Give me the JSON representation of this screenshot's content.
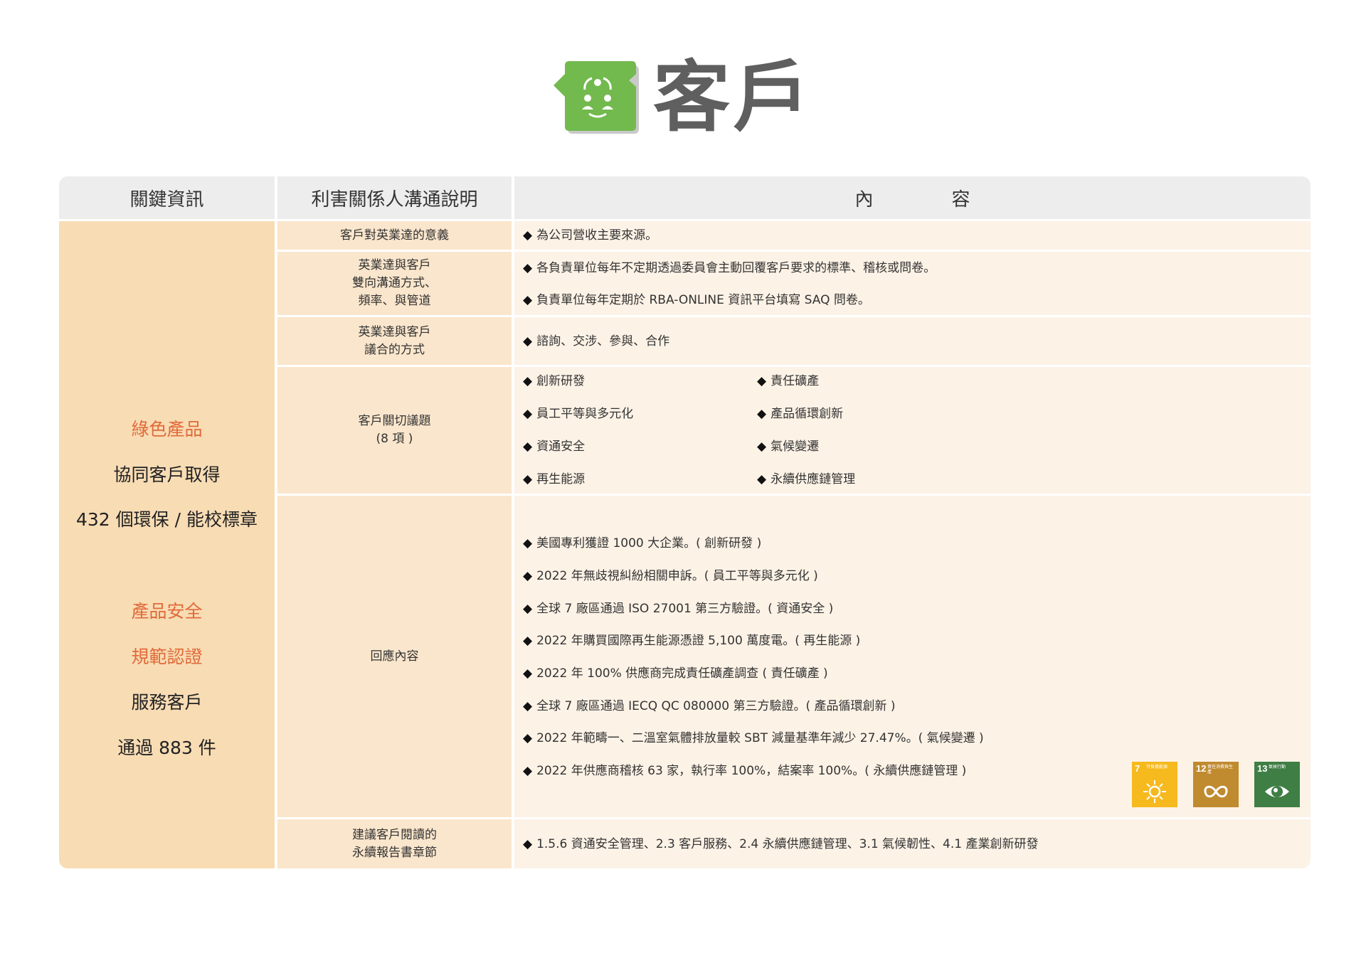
{
  "header": {
    "title": "客戶",
    "icon": "stakeholder-customer-icon",
    "icon_color": "#72b94e"
  },
  "table": {
    "col1_header": "關鍵資訊",
    "col2_header": "利害關係人溝通說明",
    "col3_header_a": "內",
    "col3_header_b": "容",
    "key_info": {
      "l1": "綠色產品",
      "l2": "協同客戶取得",
      "l3": "432 個環保 / 能校標章",
      "l4": "產品安全",
      "l5": "規範認證",
      "l6": "服務客戶",
      "l7": "通過 883 件",
      "highlight_color": "#e06a3a"
    },
    "rows": {
      "significance": {
        "label": "客戶對英業達的意義",
        "items": [
          "為公司營收主要來源。"
        ]
      },
      "channels": {
        "label_1": "英業達與客戶",
        "label_2": "雙向溝通方式、",
        "label_3": "頻率、與管道",
        "items": [
          "各負責單位每年不定期透過委員會主動回覆客戶要求的標準、稽核或問卷。",
          "負責單位每年定期於 RBA-ONLINE 資訊平台填寫 SAQ 問卷。"
        ]
      },
      "engagement": {
        "label_1": "英業達與客戶",
        "label_2": "議合的方式",
        "items": [
          "諮詢、交涉、參與、合作"
        ]
      },
      "topics": {
        "label_1": "客戶關切議題",
        "label_2": "(8 項 )",
        "left": [
          "創新研發",
          "員工平等與多元化",
          "資通安全",
          "再生能源"
        ],
        "right": [
          "責任礦產",
          "產品循環創新",
          "氣候變遷",
          "永續供應鏈管理"
        ]
      },
      "response": {
        "label": "回應內容",
        "items": [
          "美國專利獲證 1000 大企業。( 創新研發 )",
          "2022 年無歧視糾紛相關申訴。( 員工平等與多元化 )",
          "全球 7 廠區通過 ISO 27001 第三方驗證。( 資通安全 )",
          "2022 年購買國際再生能源憑證 5,100 萬度電。( 再生能源 )",
          "2022 年 100% 供應商完成責任礦產調查 ( 責任礦產 )",
          "全球 7 廠區通過 IECQ QC 080000 第三方驗證。( 產品循環創新 )",
          "2022 年範疇一、二溫室氣體排放量較 SBT 減量基準年減少 27.47%。( 氣候變遷 )",
          "2022 年供應商稽核 63 家，執行率 100%，結案率 100%。( 永續供應鏈管理 )"
        ],
        "sdgs": [
          {
            "num": "7",
            "text": "可負擔能源",
            "color": "#f6b91e",
            "icon": "sun-icon"
          },
          {
            "num": "12",
            "text": "責任消費與生產",
            "color": "#c08a2e",
            "icon": "infinity-icon"
          },
          {
            "num": "13",
            "text": "氣候行動",
            "color": "#3f7e44",
            "icon": "eye-globe-icon"
          }
        ]
      },
      "chapters": {
        "label_1": "建議客戶閱讀的",
        "label_2": "永續報告書章節",
        "items": [
          "1.5.6 資通安全管理、2.3 客戶服務、2.4 永續供應鏈管理、3.1 氣候韌性、4.1 產業創新研發"
        ]
      }
    },
    "bullet": "◆"
  }
}
